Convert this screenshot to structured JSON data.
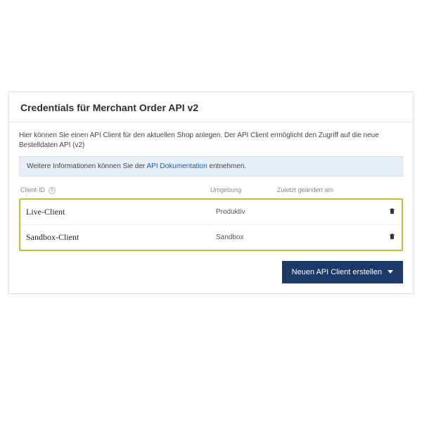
{
  "header": {
    "title": "Credentials für Merchant Order API v2"
  },
  "description": "Hier können Sie einen API Client für den aktuellen Shop anlegen. Der API Client ermöglicht den Zugriff auf die neue Bestelldaten API (v2)",
  "info_box": {
    "prefix": "Weitere Informationen können Sie der ",
    "link_text": "API Dokumentation",
    "suffix": " entnehmen."
  },
  "columns": {
    "client_id": "Client-ID",
    "environment": "Umgebung",
    "modified": "Zuletzt geändert am"
  },
  "rows": [
    {
      "client_id": "Live-Client",
      "environment": "Produktiv",
      "modified": ""
    },
    {
      "client_id": "Sandbox-Client",
      "environment": "Sandbox",
      "modified": ""
    }
  ],
  "buttons": {
    "create": "Neuen API Client erstellen"
  }
}
